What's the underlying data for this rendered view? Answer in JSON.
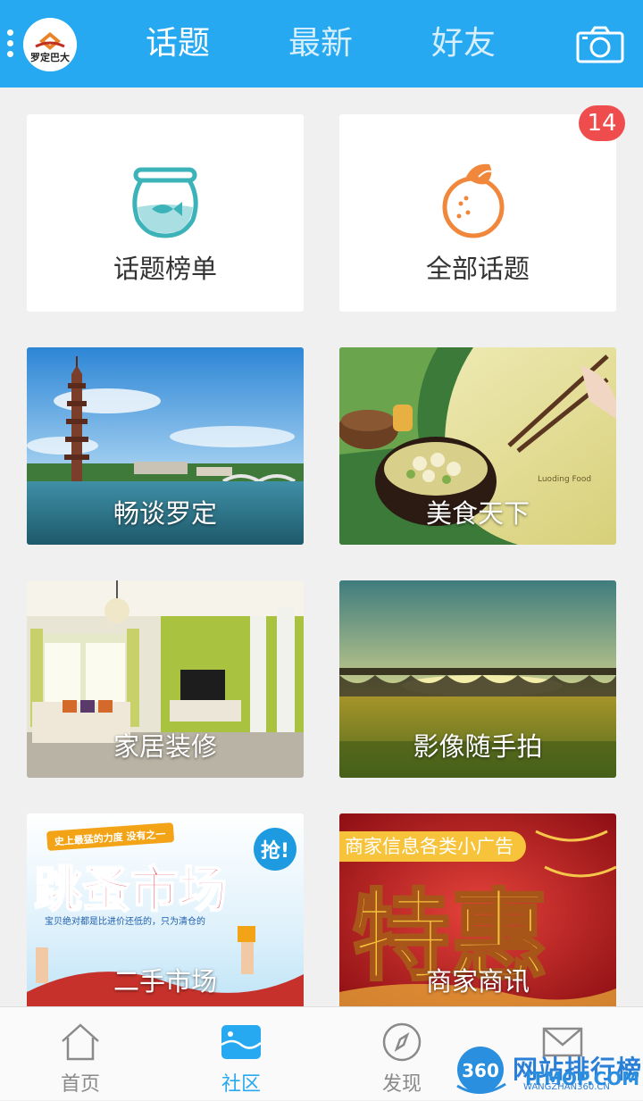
{
  "header": {
    "logo_text": "罗定巴大",
    "tabs": [
      {
        "label": "话题",
        "active": true
      },
      {
        "label": "最新",
        "active": false
      },
      {
        "label": "好友",
        "active": false
      }
    ],
    "camera_icon": "camera-icon"
  },
  "grid": {
    "top_cards": [
      {
        "label": "话题榜单",
        "icon": "fishbowl-icon"
      },
      {
        "label": "全部话题",
        "icon": "orange-icon",
        "badge": "14"
      }
    ],
    "image_cards": [
      {
        "label": "畅谈罗定"
      },
      {
        "label": "美食天下",
        "image_caption": "Luoding Food"
      },
      {
        "label": "家居装修"
      },
      {
        "label": "影像随手拍"
      },
      {
        "label": "二手市场",
        "image_title": "跳蚤市场",
        "image_tag": "史上最猛的力度 没有之一",
        "image_sub": "宝贝绝对都是比进价还低的，只为清仓的",
        "image_badge": "抢!"
      },
      {
        "label": "商家商讯",
        "tag": "商家信息各类小广告",
        "image_title": "特惠"
      }
    ]
  },
  "bottom_nav": {
    "items": [
      {
        "label": "首页",
        "icon": "home-icon",
        "active": false
      },
      {
        "label": "社区",
        "icon": "community-icon",
        "active": true
      },
      {
        "label": "发现",
        "icon": "compass-icon",
        "active": false
      },
      {
        "label": "",
        "icon": "mail-icon",
        "active": false
      }
    ]
  },
  "watermark": {
    "logo": "360",
    "title": "网站排行榜",
    "overlay": "ITMOP.COM",
    "sub": "WANGZHAN360.CN"
  },
  "colors": {
    "accent": "#27a9f1",
    "badge": "#ef4d4d",
    "ad_tag": "#f7c33a"
  }
}
